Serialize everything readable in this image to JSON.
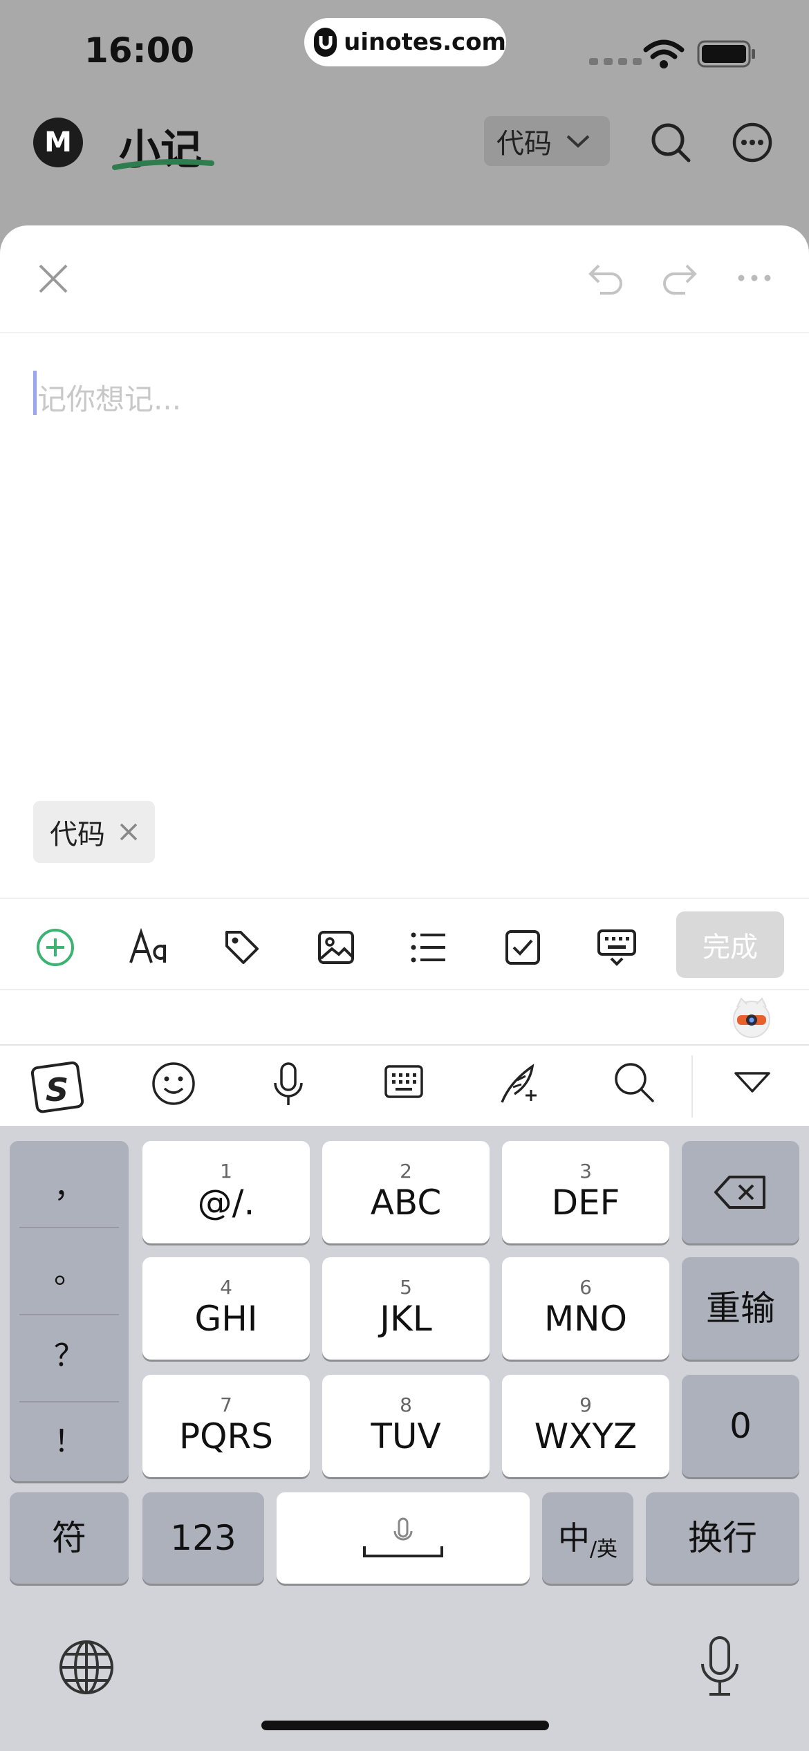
{
  "status_bar": {
    "time": "16:00",
    "url": "uinotes.com",
    "icons": [
      "signal-icon",
      "wifi-icon",
      "battery-icon"
    ]
  },
  "app_header": {
    "logo_letter": "M",
    "title": "小记",
    "filter": "代码",
    "icons": [
      "search-icon",
      "more-icon"
    ]
  },
  "editor": {
    "placeholder": "记你想记...",
    "tag": "代码",
    "toolbar_icons": [
      "add-circle-icon",
      "text-format-icon",
      "tag-icon",
      "image-icon",
      "list-icon",
      "checkbox-icon",
      "keyboard-hide-icon"
    ],
    "done_label": "完成",
    "colors": {
      "accent_green": "#3cb371",
      "done_disabled": "#d9d9d9"
    }
  },
  "ime_bar": {
    "icons": [
      "sogou-logo-icon",
      "emoji-icon",
      "microphone-icon",
      "keyboard-icon",
      "handwriting-icon",
      "search-icon",
      "collapse-icon"
    ]
  },
  "keyboard": {
    "punctuation": [
      "，",
      "。",
      "？",
      "！"
    ],
    "keys": [
      {
        "num": "1",
        "label": "@/."
      },
      {
        "num": "2",
        "label": "ABC"
      },
      {
        "num": "3",
        "label": "DEF"
      },
      {
        "num": "4",
        "label": "GHI"
      },
      {
        "num": "5",
        "label": "JKL"
      },
      {
        "num": "6",
        "label": "MNO"
      },
      {
        "num": "7",
        "label": "PQRS"
      },
      {
        "num": "8",
        "label": "TUV"
      },
      {
        "num": "9",
        "label": "WXYZ"
      }
    ],
    "retype": "重输",
    "zero": "0",
    "symbols": "符",
    "numbers": "123",
    "lang_main": "中",
    "lang_sub": "/英",
    "enter": "换行"
  }
}
